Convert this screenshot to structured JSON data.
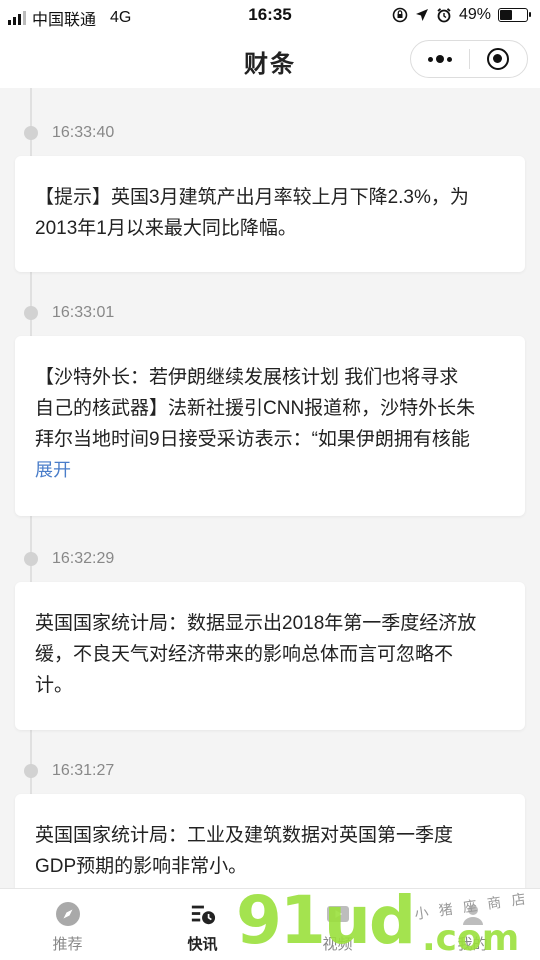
{
  "status_bar": {
    "carrier": "中国联通",
    "network": "4G",
    "time": "16:35",
    "battery_pct": "49%",
    "battery_level": 0.49
  },
  "nav": {
    "title": "财条"
  },
  "feed": [
    {
      "time": "16:33:40",
      "lines": [
        "【提示】英国3月建筑产出月率较上月下降2.3%，为",
        "2013年1月以来最大同比降幅。"
      ],
      "expand": ""
    },
    {
      "time": "16:33:01",
      "lines": [
        "【沙特外长：若伊朗继续发展核计划 我们也将寻求",
        "自己的核武器】法新社援引CNN报道称，沙特外长朱",
        "拜尔当地时间9日接受采访表示：“如果伊朗拥有核能"
      ],
      "expand": "展开"
    },
    {
      "time": "16:32:29",
      "lines": [
        "英国国家统计局：数据显示出2018年第一季度经济放",
        "缓，不良天气对经济带来的影响总体而言可忽略不",
        "计。"
      ],
      "expand": ""
    },
    {
      "time": "16:31:27",
      "lines": [
        "英国国家统计局：工业及建筑数据对英国第一季度",
        "GDP预期的影响非常小。"
      ],
      "expand": ""
    }
  ],
  "tabs": [
    {
      "label": "推荐",
      "icon": "compass-icon"
    },
    {
      "label": "快讯",
      "icon": "news-clock-icon"
    },
    {
      "label": "视频",
      "icon": "video-icon"
    },
    {
      "label": "我的",
      "icon": "user-icon"
    }
  ],
  "watermark": {
    "big": "91ud",
    "com": ".com",
    "script": "小 猪 座 商 店"
  },
  "colors": {
    "link": "#4a7dc9",
    "watermark": "#9be03c"
  }
}
